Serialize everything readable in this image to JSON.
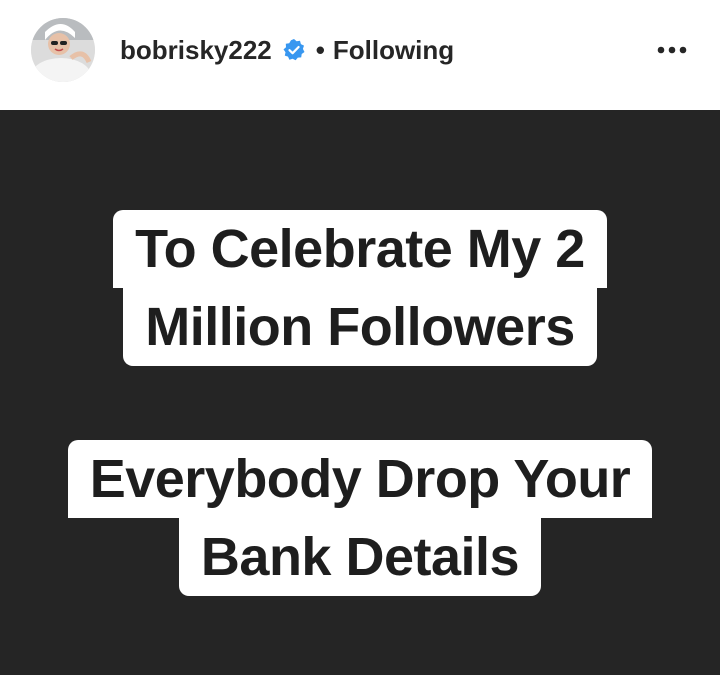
{
  "header": {
    "username": "bobrisky222",
    "verified_icon": "verified-badge-icon",
    "separator": "•",
    "follow_status": "Following",
    "more_icon": "more-options-icon",
    "accent_color": "#3897f0"
  },
  "story": {
    "background_color": "#252525",
    "caption_1": {
      "line_1": "To Celebrate My 2",
      "line_2": "Million Followers"
    },
    "caption_2": {
      "line_1": "Everybody Drop Your",
      "line_2": "Bank Details"
    }
  }
}
